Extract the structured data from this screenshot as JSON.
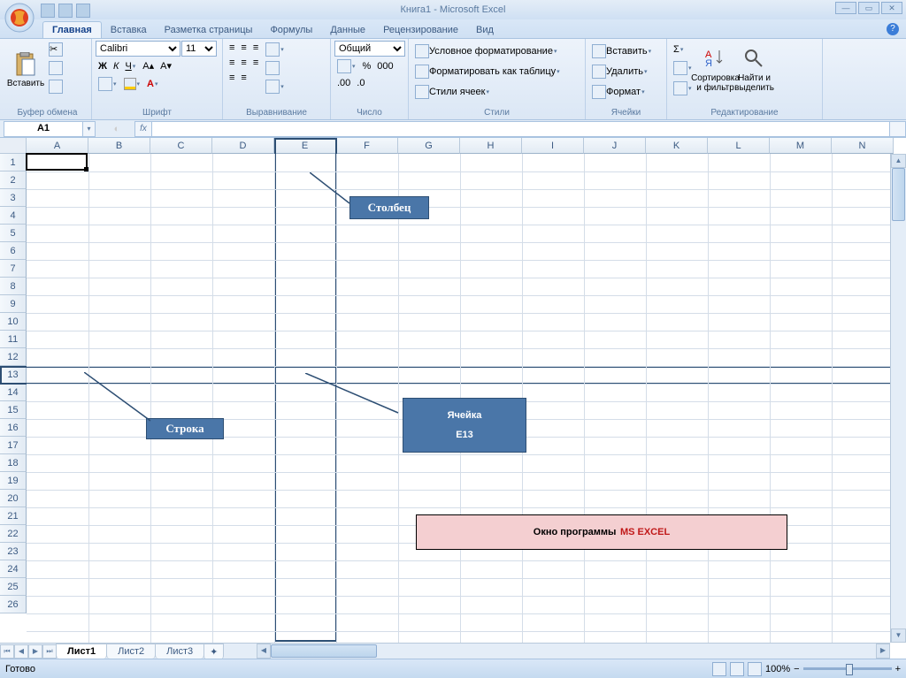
{
  "title": "Книга1 - Microsoft Excel",
  "tabs": [
    "Главная",
    "Вставка",
    "Разметка страницы",
    "Формулы",
    "Данные",
    "Рецензирование",
    "Вид"
  ],
  "tabActive": 0,
  "ribbon": {
    "clipboard": {
      "title": "Буфер обмена",
      "paste": "Вставить"
    },
    "font": {
      "title": "Шрифт",
      "name": "Calibri",
      "size": "11"
    },
    "align": {
      "title": "Выравнивание"
    },
    "number": {
      "title": "Число",
      "format": "Общий"
    },
    "styles": {
      "title": "Стили",
      "cond": "Условное форматирование",
      "table": "Форматировать как таблицу",
      "cell": "Стили ячеек"
    },
    "cells": {
      "title": "Ячейки",
      "insert": "Вставить",
      "delete": "Удалить",
      "format": "Формат"
    },
    "edit": {
      "title": "Редактирование",
      "sort": "Сортировка и фильтр",
      "find": "Найти и выделить"
    }
  },
  "namebox": "A1",
  "formula": "",
  "columns": [
    "A",
    "B",
    "C",
    "D",
    "E",
    "F",
    "G",
    "H",
    "I",
    "J",
    "K",
    "L",
    "M",
    "N"
  ],
  "rowCount": 26,
  "sheetTabs": [
    "Лист1",
    "Лист2",
    "Лист3"
  ],
  "sheetActive": 0,
  "status": "Готово",
  "zoom": "100%",
  "annotations": {
    "column": "Столбец",
    "row": "Строка",
    "cell_l1": "Ячейка",
    "cell_l2": "Е13",
    "title_black": "Окно программы ",
    "title_red": "MS EXCEL"
  }
}
